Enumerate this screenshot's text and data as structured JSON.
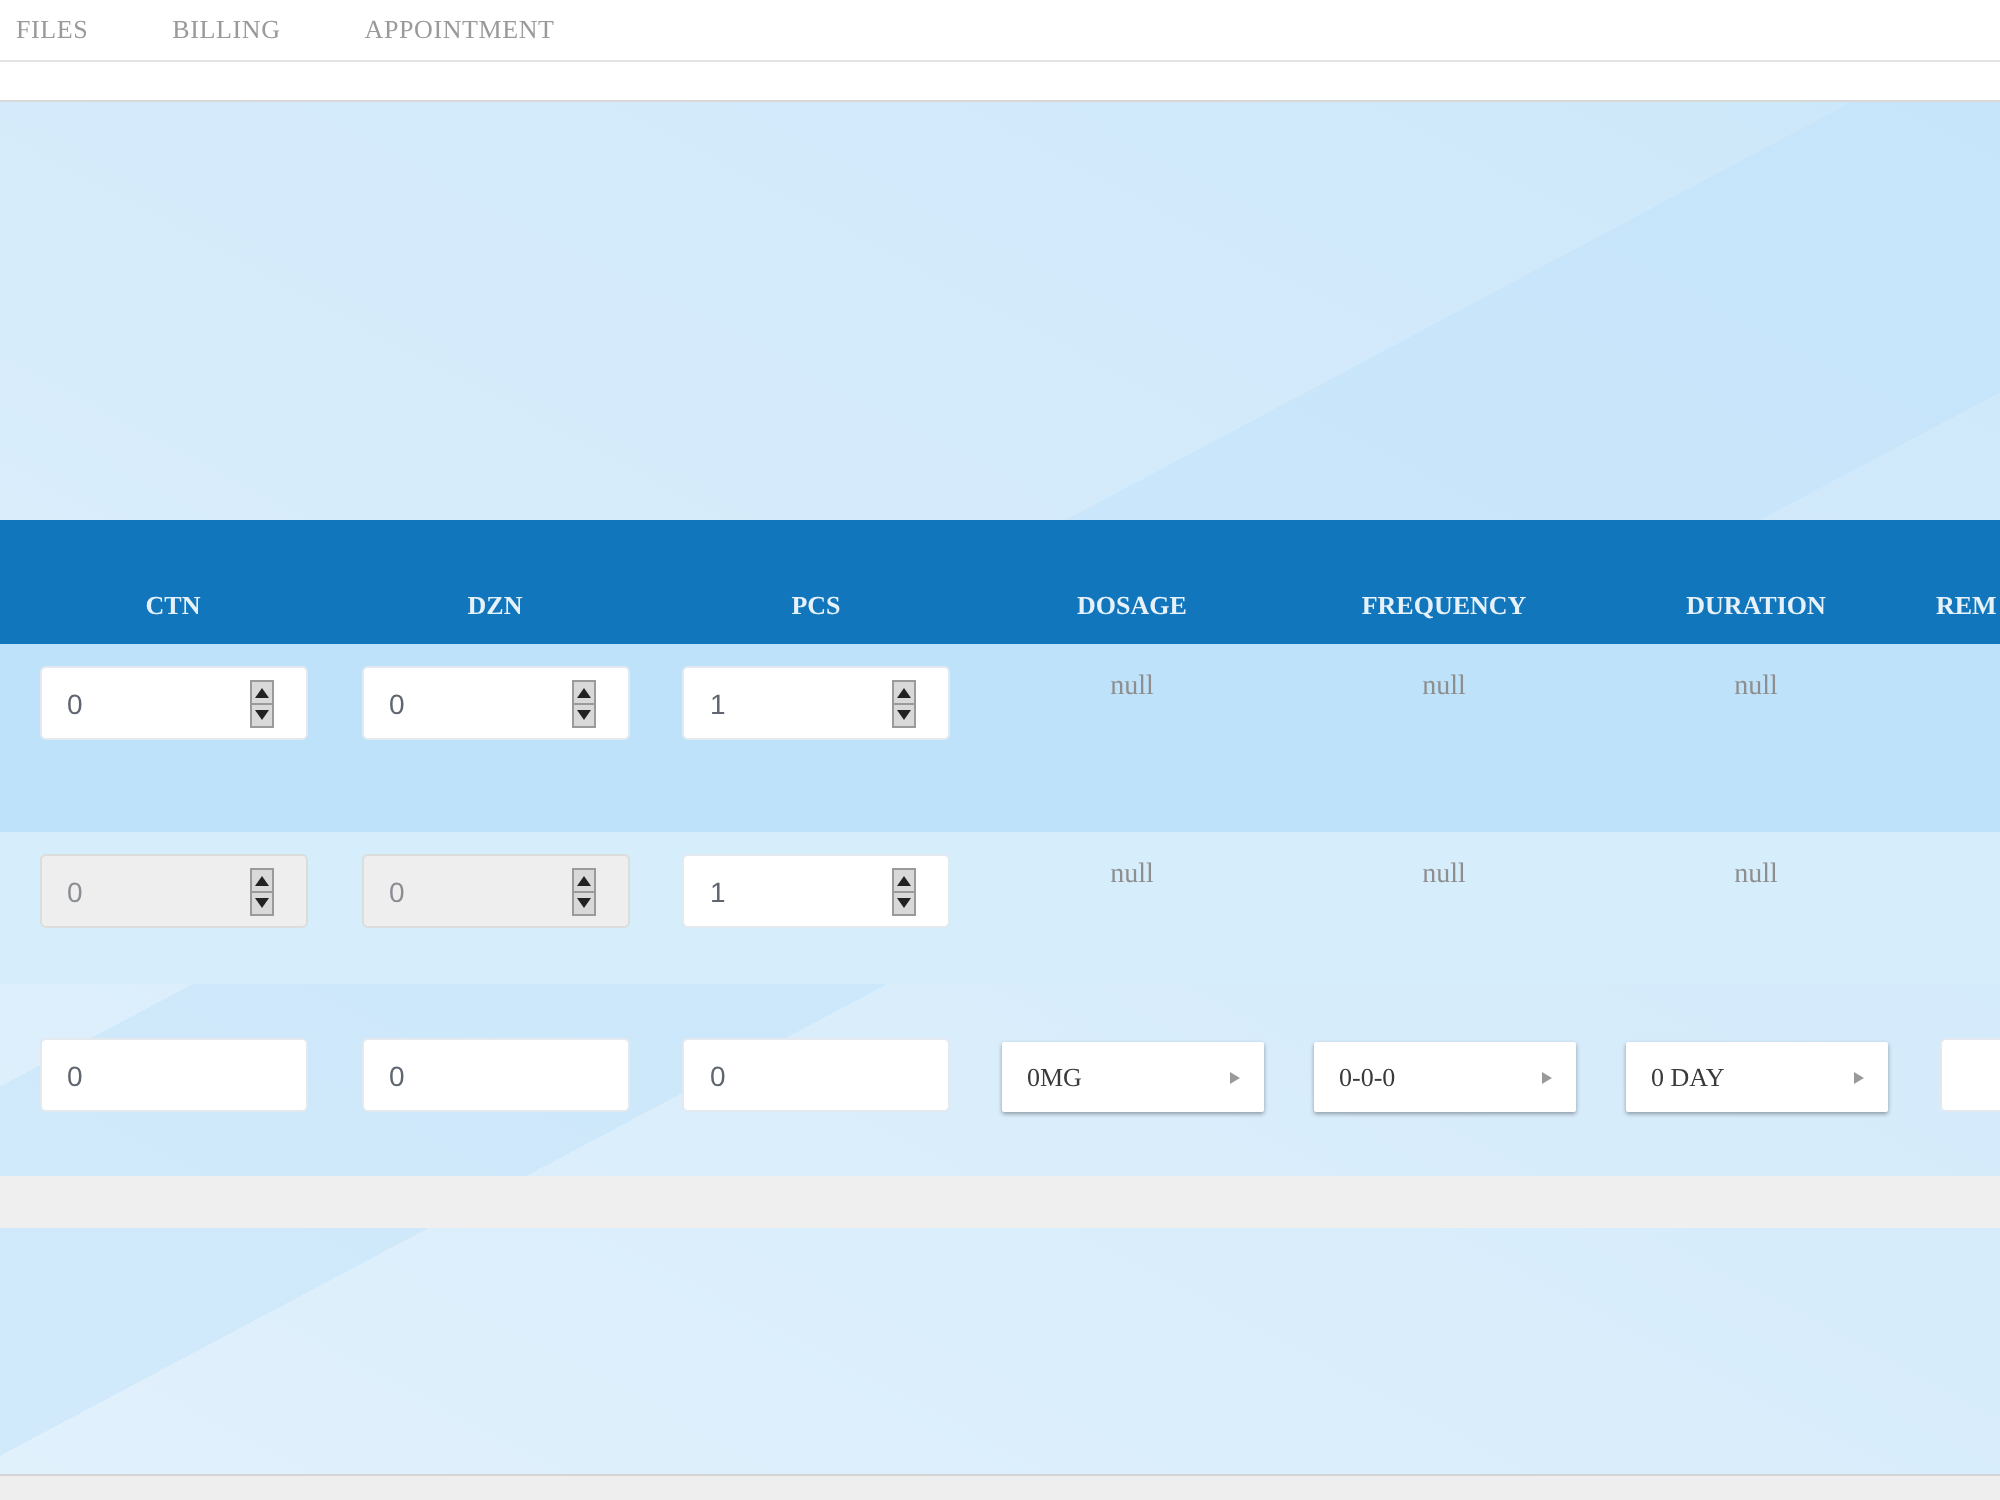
{
  "nav": {
    "items": [
      {
        "label": "FILES"
      },
      {
        "label": "BILLING"
      },
      {
        "label": "APPOINTMENT"
      }
    ]
  },
  "table": {
    "columns": [
      {
        "label": "CTN"
      },
      {
        "label": "DZN"
      },
      {
        "label": "PCS"
      },
      {
        "label": "DOSAGE"
      },
      {
        "label": "FREQUENCY"
      },
      {
        "label": "DURATION"
      },
      {
        "label": "REM"
      }
    ],
    "rows": [
      {
        "quantities": [
          {
            "value": "0",
            "disabled": false
          },
          {
            "value": "0",
            "disabled": false
          },
          {
            "value": "1",
            "disabled": false
          }
        ],
        "details": [
          "null",
          "null",
          "null"
        ]
      },
      {
        "quantities": [
          {
            "value": "0",
            "disabled": true
          },
          {
            "value": "0",
            "disabled": true
          },
          {
            "value": "1",
            "disabled": false
          }
        ],
        "details": [
          "null",
          "null",
          "null"
        ]
      }
    ],
    "entry_row": {
      "fields": [
        {
          "kind": "number",
          "value": "0"
        },
        {
          "kind": "number",
          "value": "0"
        },
        {
          "kind": "number",
          "value": "0"
        },
        {
          "kind": "select",
          "value": "0MG"
        },
        {
          "kind": "select",
          "value": "0-0-0"
        },
        {
          "kind": "select",
          "value": "0 DAY"
        },
        {
          "kind": "text"
        }
      ]
    }
  }
}
